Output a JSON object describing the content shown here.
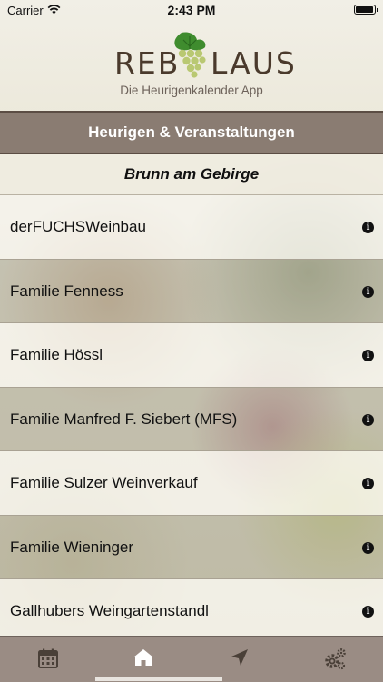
{
  "status_bar": {
    "carrier": "Carrier",
    "time": "2:43 PM"
  },
  "logo": {
    "word_left": "REB",
    "word_right": "LAUS",
    "tagline": "Die Heurigenkalender App"
  },
  "header": {
    "title": "Heurigen & Veranstaltungen"
  },
  "location": {
    "name": "Brunn am Gebirge"
  },
  "list": [
    {
      "name": "derFUCHSWeinbau"
    },
    {
      "name": "Familie Fenness"
    },
    {
      "name": "Familie Hössl"
    },
    {
      "name": "Familie Manfred F. Siebert (MFS)"
    },
    {
      "name": "Familie Sulzer Weinverkauf"
    },
    {
      "name": "Familie Wieninger"
    },
    {
      "name": "Gallhubers Weingartenstandl"
    }
  ],
  "info_glyph": "i",
  "tab_bar": {
    "tabs": [
      {
        "icon": "calendar-icon"
      },
      {
        "icon": "home-icon",
        "selected": true
      },
      {
        "icon": "location-arrow-icon"
      },
      {
        "icon": "settings-gears-icon"
      }
    ]
  },
  "colors": {
    "header": "#8a7c72",
    "tab_bar": "#9a8c84",
    "text": "#111111"
  }
}
